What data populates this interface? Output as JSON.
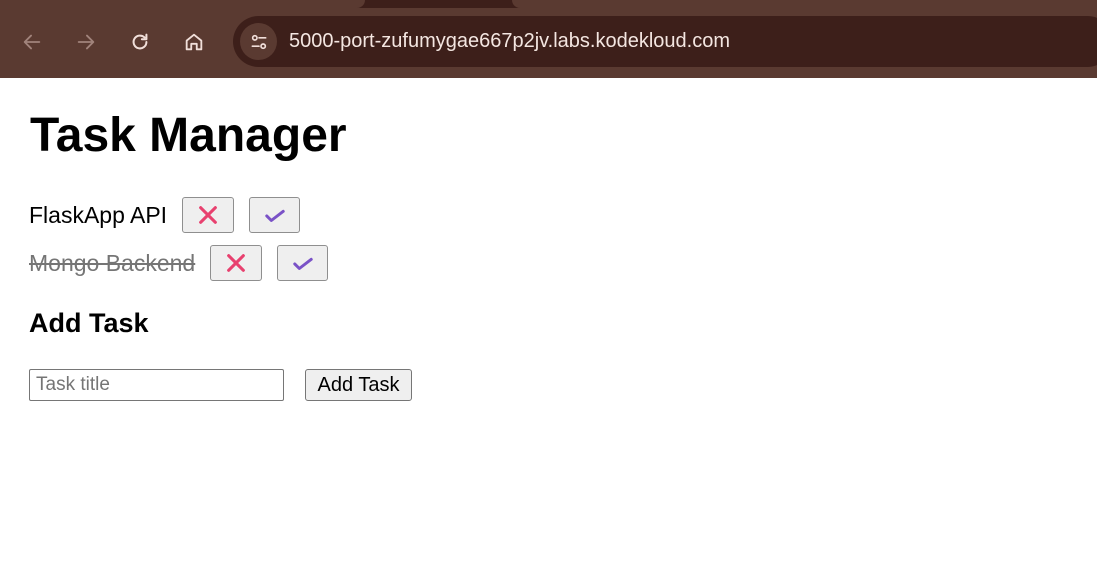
{
  "browser": {
    "url": "5000-port-zufumygae667p2jv.labs.kodekloud.com",
    "nav_icons": [
      "back-icon",
      "forward-icon",
      "reload-icon",
      "home-icon"
    ],
    "site_info_icon": "tune-icon"
  },
  "page": {
    "title": "Task Manager",
    "tasks": [
      {
        "title": "FlaskApp API",
        "completed": false
      },
      {
        "title": "Mongo Backend",
        "completed": true
      }
    ],
    "delete_icon": "cross-mark-icon",
    "complete_icon": "check-mark-icon",
    "add_section": {
      "heading": "Add Task",
      "input_placeholder": "Task title",
      "input_value": "",
      "button_label": "Add Task"
    }
  },
  "colors": {
    "chrome_bg": "#5a3a31",
    "omnibox_bg": "#3d1f1a",
    "delete_icon": "#e8416f",
    "complete_icon": "#7a52c7",
    "done_text": "#757575"
  }
}
